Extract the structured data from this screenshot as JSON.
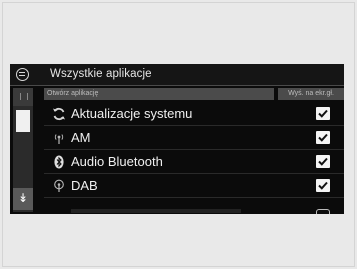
{
  "header": {
    "title": "Wszystkie aplikacje"
  },
  "columns": {
    "name": "Otwórz aplikację",
    "flag": "Wyś. na ekr.gł."
  },
  "apps": [
    {
      "label": "Aktualizacje systemu",
      "icon": "refresh-icon",
      "checked": true
    },
    {
      "label": "AM",
      "icon": "radio-antenna-icon",
      "checked": true
    },
    {
      "label": "Audio Bluetooth",
      "icon": "bluetooth-icon",
      "checked": true
    },
    {
      "label": "DAB",
      "icon": "radio-antenna-icon",
      "checked": true
    }
  ],
  "scrollbar": {
    "down_glyph": "↡"
  },
  "colors": {
    "screen_bg": "#0b0b0b",
    "checkbox": "#f4f4f4",
    "header_strip": "#4b4b4b"
  }
}
